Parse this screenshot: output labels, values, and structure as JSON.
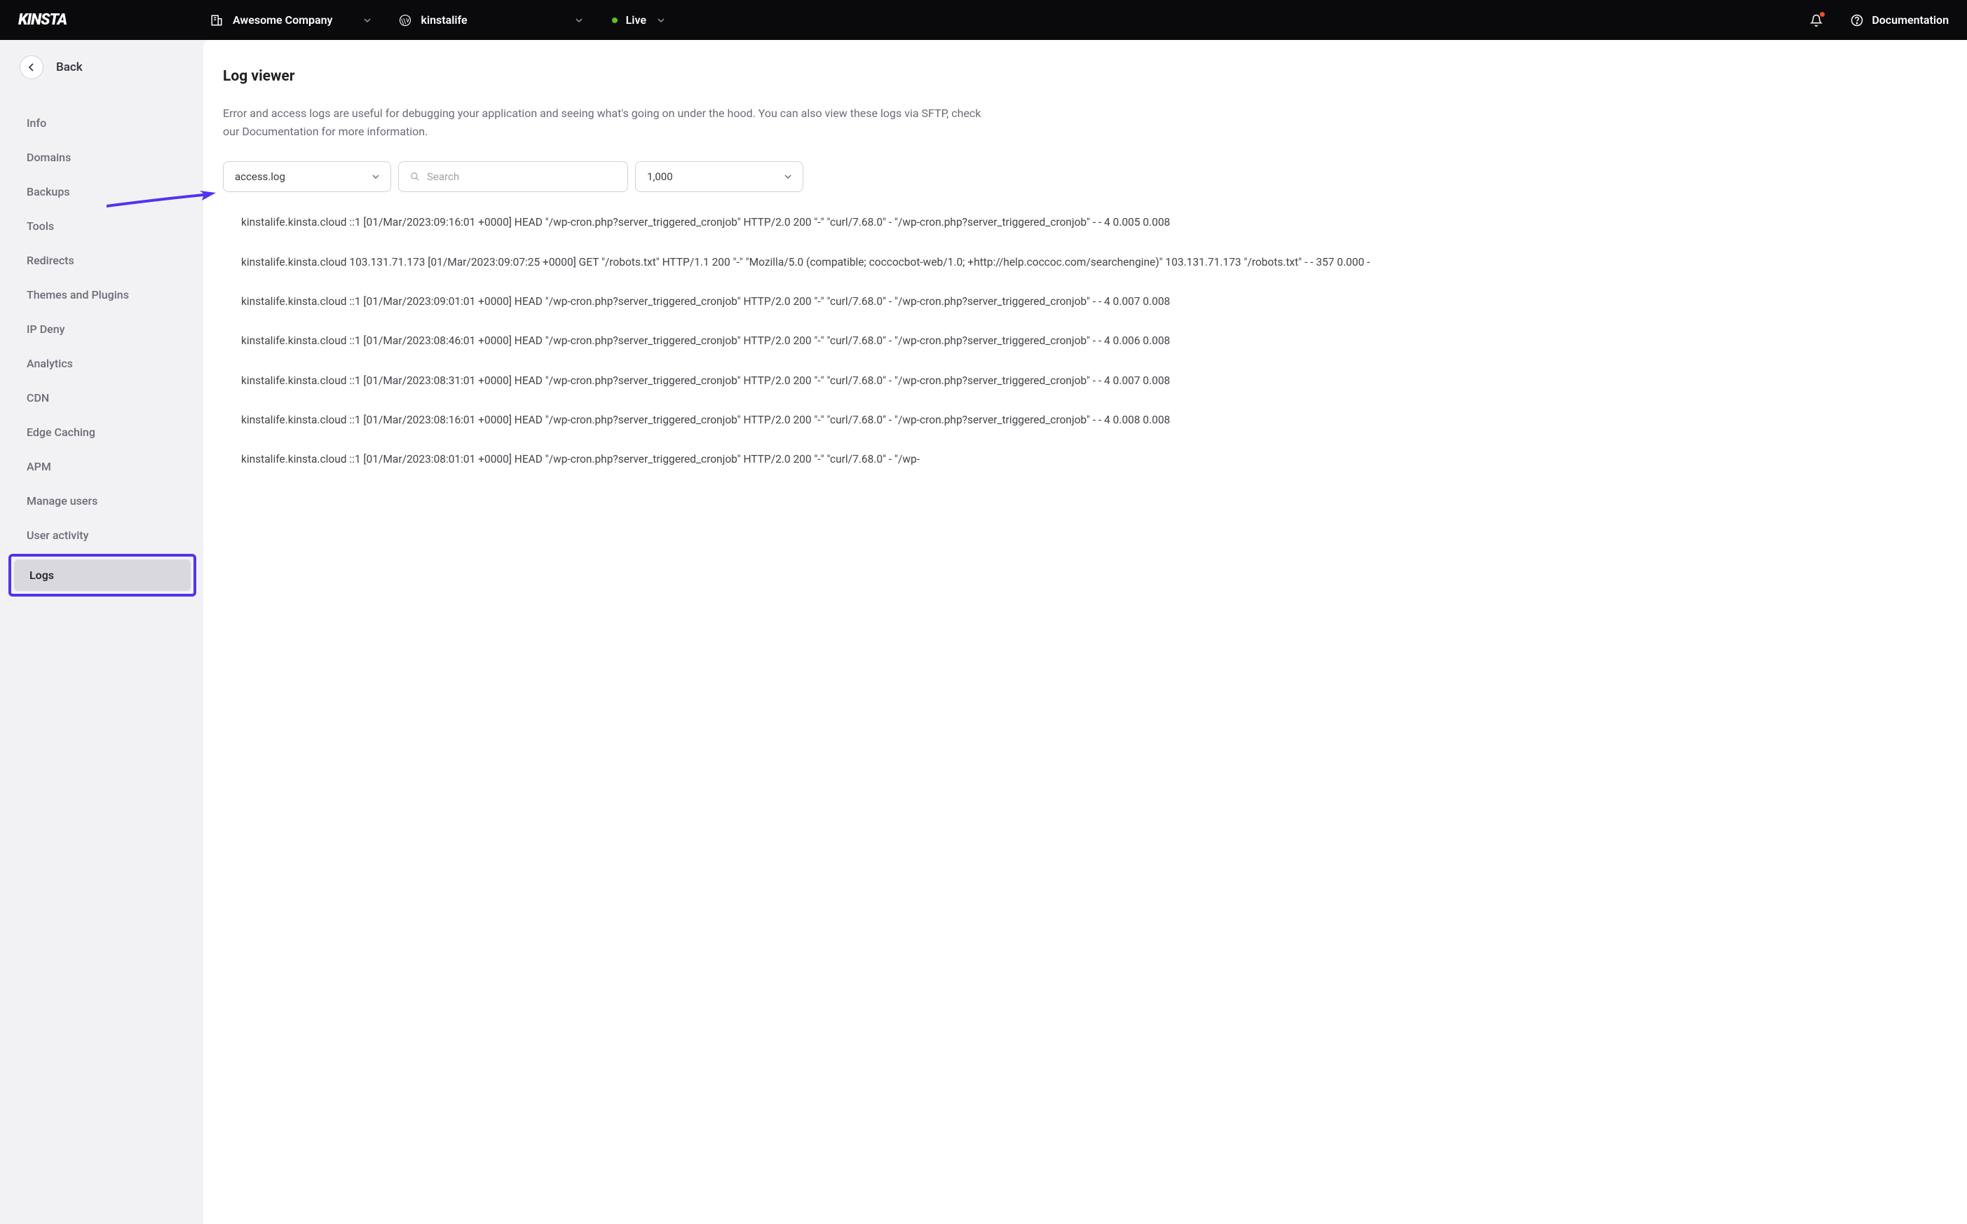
{
  "header": {
    "logo_text": "KINSTA",
    "company_selector_label": "Awesome Company",
    "site_selector_label": "kinstalife",
    "environment_label": "Live",
    "documentation_label": "Documentation"
  },
  "sidebar": {
    "back_label": "Back",
    "items": [
      {
        "label": "Info"
      },
      {
        "label": "Domains"
      },
      {
        "label": "Backups"
      },
      {
        "label": "Tools"
      },
      {
        "label": "Redirects"
      },
      {
        "label": "Themes and Plugins"
      },
      {
        "label": "IP Deny"
      },
      {
        "label": "Analytics"
      },
      {
        "label": "CDN"
      },
      {
        "label": "Edge Caching"
      },
      {
        "label": "APM"
      },
      {
        "label": "Manage users"
      },
      {
        "label": "User activity"
      },
      {
        "label": "Logs"
      }
    ],
    "active_index": 13
  },
  "main": {
    "title": "Log viewer",
    "description": "Error and access logs are useful for debugging your application and seeing what's going on under the hood. You can also view these logs via SFTP, check our Documentation for more information.",
    "file_select_value": "access.log",
    "search_placeholder": "Search",
    "count_select_value": "1,000",
    "log_entries": [
      "kinstalife.kinsta.cloud ::1 [01/Mar/2023:09:16:01 +0000] HEAD \"/wp-cron.php?server_triggered_cronjob\" HTTP/2.0 200 \"-\" \"curl/7.68.0\" - \"/wp-cron.php?server_triggered_cronjob\" - - 4 0.005 0.008",
      "kinstalife.kinsta.cloud 103.131.71.173 [01/Mar/2023:09:07:25 +0000] GET \"/robots.txt\" HTTP/1.1 200 \"-\" \"Mozilla/5.0 (compatible; coccocbot-web/1.0; +http://help.coccoc.com/searchengine)\" 103.131.71.173 \"/robots.txt\" - - 357 0.000 -",
      "kinstalife.kinsta.cloud ::1 [01/Mar/2023:09:01:01 +0000] HEAD \"/wp-cron.php?server_triggered_cronjob\" HTTP/2.0 200 \"-\" \"curl/7.68.0\" - \"/wp-cron.php?server_triggered_cronjob\" - - 4 0.007 0.008",
      "kinstalife.kinsta.cloud ::1 [01/Mar/2023:08:46:01 +0000] HEAD \"/wp-cron.php?server_triggered_cronjob\" HTTP/2.0 200 \"-\" \"curl/7.68.0\" - \"/wp-cron.php?server_triggered_cronjob\" - - 4 0.006 0.008",
      "kinstalife.kinsta.cloud ::1 [01/Mar/2023:08:31:01 +0000] HEAD \"/wp-cron.php?server_triggered_cronjob\" HTTP/2.0 200 \"-\" \"curl/7.68.0\" - \"/wp-cron.php?server_triggered_cronjob\" - - 4 0.007 0.008",
      "kinstalife.kinsta.cloud ::1 [01/Mar/2023:08:16:01 +0000] HEAD \"/wp-cron.php?server_triggered_cronjob\" HTTP/2.0 200 \"-\" \"curl/7.68.0\" - \"/wp-cron.php?server_triggered_cronjob\" - - 4 0.008 0.008",
      "kinstalife.kinsta.cloud ::1 [01/Mar/2023:08:01:01 +0000] HEAD \"/wp-cron.php?server_triggered_cronjob\" HTTP/2.0 200 \"-\" \"curl/7.68.0\" - \"/wp-"
    ]
  }
}
